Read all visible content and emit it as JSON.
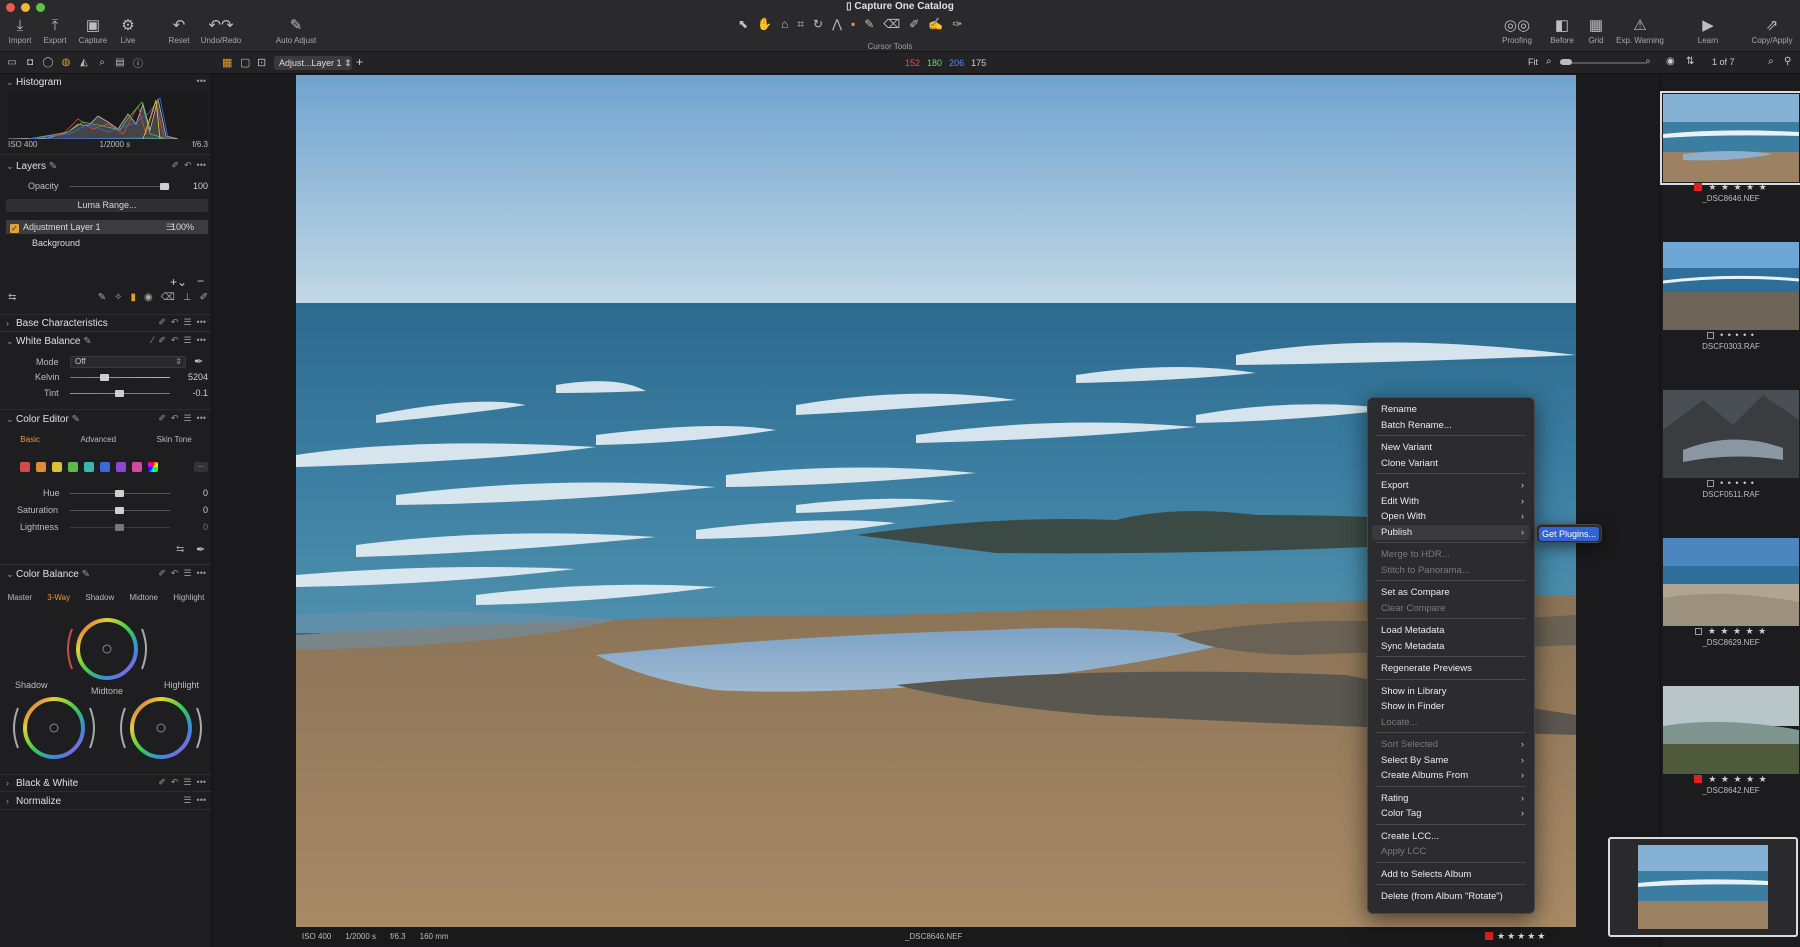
{
  "window": {
    "title": "Capture One Catalog"
  },
  "toolbar": {
    "left": [
      {
        "label": "Import",
        "icon": "import-icon"
      },
      {
        "label": "Export",
        "icon": "export-icon"
      },
      {
        "label": "Capture",
        "icon": "capture-icon"
      },
      {
        "label": "Live",
        "icon": "live-icon"
      },
      {
        "label": "Reset",
        "icon": "reset-icon"
      },
      {
        "label": "Undo/Redo",
        "icon": "undo-redo-icon"
      },
      {
        "label": "Auto Adjust",
        "icon": "auto-adjust-icon"
      }
    ],
    "cursor_tools_label": "Cursor Tools",
    "right": [
      {
        "label": "Proofing",
        "icon": "proofing-icon"
      },
      {
        "label": "Before",
        "icon": "before-icon"
      },
      {
        "label": "Grid",
        "icon": "grid-icon"
      },
      {
        "label": "Exp. Warning",
        "icon": "exposure-warning-icon"
      },
      {
        "label": "Learn",
        "icon": "learn-icon"
      },
      {
        "label": "Copy/Apply",
        "icon": "copy-apply-icon"
      }
    ]
  },
  "subbar": {
    "layer_select": "Adjust...Layer 1",
    "readout": {
      "r": "152",
      "g": "180",
      "b": "206",
      "l": "175"
    },
    "fit": "Fit",
    "counter": "1 of 7"
  },
  "left": {
    "histogram": {
      "title": "Histogram",
      "iso": "ISO 400",
      "shutter": "1/2000 s",
      "aperture": "f/6.3"
    },
    "layers": {
      "title": "Layers",
      "opacity_label": "Opacity",
      "opacity_value": "100",
      "luma_button": "Luma Range...",
      "items": [
        {
          "name": "Adjustment Layer 1",
          "opacity": "100%"
        },
        {
          "name": "Background"
        }
      ]
    },
    "base_characteristics": {
      "title": "Base Characteristics"
    },
    "white_balance": {
      "title": "White Balance",
      "mode_label": "Mode",
      "mode_value": "Off",
      "kelvin_label": "Kelvin",
      "kelvin_value": "5204",
      "tint_label": "Tint",
      "tint_value": "-0.1"
    },
    "color_editor": {
      "title": "Color Editor",
      "tabs": [
        "Basic",
        "Advanced",
        "Skin Tone"
      ],
      "more": "...",
      "hue_label": "Hue",
      "hue_value": "0",
      "saturation_label": "Saturation",
      "saturation_value": "0",
      "lightness_label": "Lightness",
      "lightness_value": "0",
      "swatches": [
        "#d24a4a",
        "#e08a3a",
        "#d8c23a",
        "#5cb84a",
        "#3ab8b0",
        "#3a6ad8",
        "#8a4ad0",
        "#d04aa0"
      ]
    },
    "color_balance": {
      "title": "Color Balance",
      "tabs": [
        "Master",
        "3-Way",
        "Shadow",
        "Midtone",
        "Highlight"
      ],
      "wheels": [
        "Shadow",
        "Midtone",
        "Highlight"
      ]
    },
    "black_white": {
      "title": "Black & White"
    },
    "normalize": {
      "title": "Normalize"
    }
  },
  "viewer": {
    "iso": "ISO 400",
    "shutter": "1/2000 s",
    "aperture": "f/6.3",
    "focal": "160 mm",
    "filename": "_DSC8646.NEF",
    "rating": 5
  },
  "context_menu": {
    "items": [
      {
        "label": "Rename"
      },
      {
        "label": "Batch Rename..."
      },
      {
        "label": "New Variant"
      },
      {
        "label": "Clone Variant"
      },
      {
        "label": "Export",
        "sub": true
      },
      {
        "label": "Edit With",
        "sub": true
      },
      {
        "label": "Open With",
        "sub": true
      },
      {
        "label": "Publish",
        "sub": true
      },
      {
        "label": "Merge to HDR...",
        "disabled": true
      },
      {
        "label": "Stitch to Panorama...",
        "disabled": true
      },
      {
        "label": "Set as Compare"
      },
      {
        "label": "Clear Compare",
        "disabled": true
      },
      {
        "label": "Load Metadata"
      },
      {
        "label": "Sync Metadata"
      },
      {
        "label": "Regenerate Previews"
      },
      {
        "label": "Show in Library"
      },
      {
        "label": "Show in Finder"
      },
      {
        "label": "Locate...",
        "disabled": true
      },
      {
        "label": "Sort Selected",
        "disabled": true,
        "sub": true
      },
      {
        "label": "Select By Same",
        "sub": true
      },
      {
        "label": "Create Albums From",
        "sub": true
      },
      {
        "label": "Rating",
        "sub": true
      },
      {
        "label": "Color Tag",
        "sub": true
      },
      {
        "label": "Create LCC..."
      },
      {
        "label": "Apply LCC",
        "disabled": true
      },
      {
        "label": "Add to Selects Album"
      },
      {
        "label": "Delete (from Album \"Rotate\")"
      }
    ],
    "submenu_item": "Get Plugins..."
  },
  "filmstrip": {
    "items": [
      {
        "name": "_DSC8646.NEF",
        "stars": "★ ★ ★ ★ ★",
        "tag": "red"
      },
      {
        "name": "DSCF0303.RAF",
        "stars": "• • • • •",
        "tag": "box"
      },
      {
        "name": "DSCF0511.RAF",
        "stars": "• • • • •",
        "tag": "box"
      },
      {
        "name": "_DSC8629.NEF",
        "stars": "★ ★ ★ ★ ★",
        "tag": "box"
      },
      {
        "name": "_DSC8642.NEF",
        "stars": "★ ★ ★ ★ ★",
        "tag": "red"
      }
    ]
  }
}
